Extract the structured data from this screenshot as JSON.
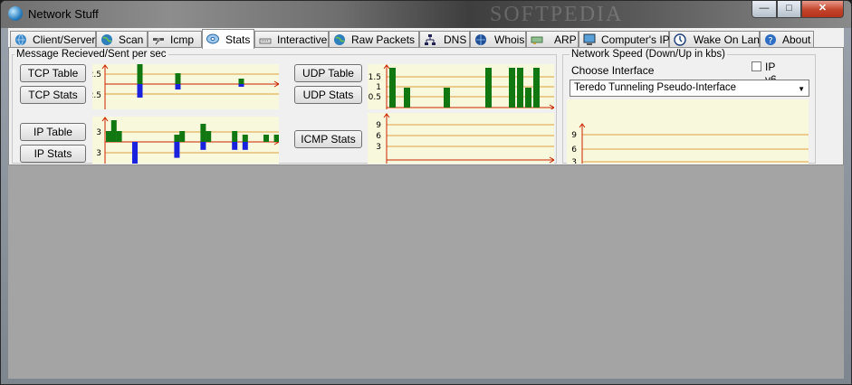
{
  "window": {
    "title": "Network Stuff",
    "watermark": "SOFTPEDIA"
  },
  "titlebar_buttons": {
    "minimize": "—",
    "maximize": "□",
    "close": "✕"
  },
  "tabs": [
    {
      "label": "Client/Server",
      "icon": "globe-icon"
    },
    {
      "label": "Scan",
      "icon": "globe-icon"
    },
    {
      "label": "Icmp",
      "icon": "satellite-icon"
    },
    {
      "label": "Stats",
      "icon": "cd-icon",
      "active": true
    },
    {
      "label": "Interactive",
      "icon": "keyboard-icon"
    },
    {
      "label": "Raw Packets",
      "icon": "globe-icon"
    },
    {
      "label": "DNS",
      "icon": "network-icon"
    },
    {
      "label": "Whois",
      "icon": "globe-icon"
    },
    {
      "label": "ARP",
      "icon": "card-icon"
    },
    {
      "label": "Computer's IP",
      "icon": "monitor-icon"
    },
    {
      "label": "Wake On Lan",
      "icon": "power-icon"
    },
    {
      "label": "About",
      "icon": "help-icon"
    }
  ],
  "stats": {
    "group_message": "Message Recieved/Sent per sec",
    "group_speed": "Network Speed (Down/Up in kbs)",
    "choose_interface": "Choose Interface",
    "ipv6_label": "IP v6",
    "interface": "Teredo Tunneling Pseudo-Interface",
    "buttons": {
      "tcp_table": "TCP Table",
      "tcp_stats": "TCP Stats",
      "ip_table": "IP Table",
      "ip_stats": "IP Stats",
      "udp_table": "UDP Table",
      "udp_stats": "UDP Stats",
      "icmp_stats": "ICMP Stats"
    }
  },
  "chart_data": [
    {
      "type": "bar",
      "name": "tcp",
      "yticks": [
        "2.5",
        "2.5"
      ],
      "up": [
        0,
        0,
        0,
        0,
        0,
        0,
        0,
        0,
        0,
        3,
        0,
        0,
        0,
        0,
        0,
        0,
        0,
        0,
        0,
        0,
        0,
        1.2,
        0,
        0,
        0,
        0,
        0,
        0,
        0,
        0,
        0,
        0,
        0,
        0,
        0,
        0,
        0,
        0,
        0,
        0,
        0,
        0.6,
        0,
        0,
        0,
        0,
        0,
        0,
        0,
        0,
        0,
        0,
        0,
        0,
        0,
        0,
        0.3,
        0.6
      ],
      "down": [
        0,
        0,
        0,
        0,
        0,
        0,
        0,
        0,
        0,
        1.5,
        0,
        0,
        0,
        0,
        0,
        0,
        0,
        0,
        0,
        0,
        0,
        0.6,
        0,
        0,
        0,
        0,
        0,
        0,
        0,
        0,
        0,
        0,
        0,
        0,
        0,
        0,
        0,
        0,
        0,
        0,
        0,
        0.3,
        0,
        0,
        0,
        0,
        0,
        0,
        0,
        0,
        0,
        0,
        0,
        0,
        0,
        0,
        0.3,
        0.6
      ],
      "color_up": "#117711",
      "color_down": "#1a22dd"
    },
    {
      "type": "bar",
      "name": "ip",
      "yticks": [
        "3",
        "3"
      ],
      "up": [
        0,
        0,
        3,
        6,
        0,
        0,
        0,
        0,
        0,
        0,
        0,
        0,
        0,
        0,
        0,
        0,
        0,
        0,
        0,
        0,
        0,
        0,
        0,
        0,
        0,
        0,
        0,
        0,
        0,
        0,
        0,
        0,
        0,
        0,
        0,
        0,
        0,
        0,
        0,
        0,
        0,
        0,
        0,
        0,
        0,
        0,
        0,
        0,
        0,
        0,
        0,
        0,
        0
      ],
      "down": [],
      "color_up": "#117711",
      "color_down": "#1a22dd"
    },
    {
      "type": "bar",
      "name": "udp",
      "yticks": [
        "1.5",
        "1",
        "0.5"
      ],
      "values": [],
      "color": "#117711"
    },
    {
      "type": "line",
      "name": "icmp",
      "yticks": [
        "9",
        "6",
        "3"
      ]
    },
    {
      "type": "line",
      "name": "speed",
      "yticks": [
        "9",
        "6",
        "3"
      ]
    }
  ],
  "colors": {
    "accent_green": "#117711",
    "accent_blue": "#1a22dd",
    "axis_red": "#cc2200",
    "grid_orange": "#e0a040",
    "plot_bg": "#f8f8dc"
  }
}
